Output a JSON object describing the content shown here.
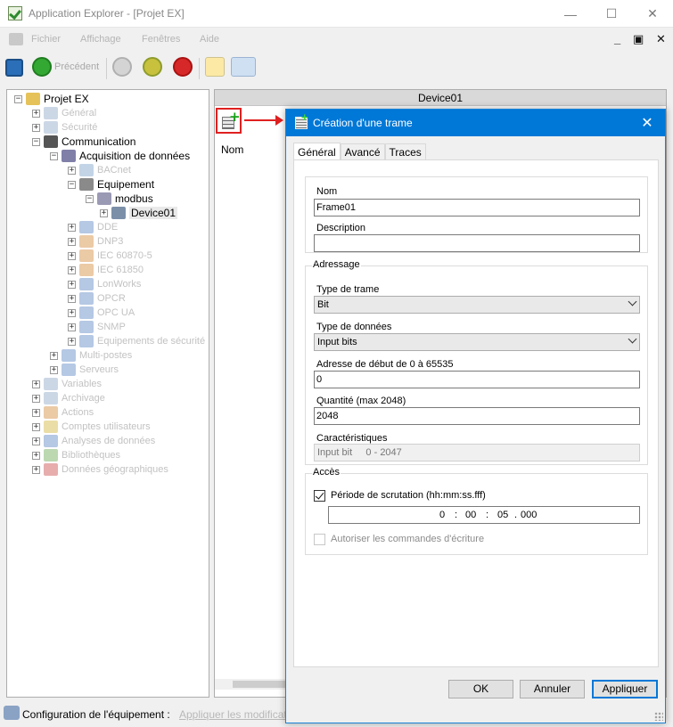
{
  "window": {
    "title": "Application Explorer - [Projet EX]",
    "controls": {
      "minimize": "—",
      "maximize": "☐",
      "close": "✕"
    }
  },
  "menu": {
    "items": [
      "Fichier",
      "Affichage",
      "Fenêtres",
      "Aide"
    ],
    "mdi_controls": {
      "minimize": "_",
      "restore": "▣",
      "close": "✕"
    }
  },
  "toolbar": {
    "previous_label": "Précédent"
  },
  "tree": {
    "root": "Projet EX",
    "items": [
      {
        "label": "Général",
        "dim": true
      },
      {
        "label": "Sécurité",
        "dim": true
      },
      {
        "label": "Communication",
        "dim": false
      },
      {
        "label": "Acquisition de données",
        "dim": false
      },
      {
        "label": "BACnet",
        "dim": true
      },
      {
        "label": "Equipement",
        "dim": false
      },
      {
        "label": "modbus",
        "dim": false
      },
      {
        "label": "Device01",
        "dim": false,
        "selected": true
      },
      {
        "label": "DDE",
        "dim": true
      },
      {
        "label": "DNP3",
        "dim": true
      },
      {
        "label": "IEC 60870-5",
        "dim": true
      },
      {
        "label": "IEC 61850",
        "dim": true
      },
      {
        "label": "LonWorks",
        "dim": true
      },
      {
        "label": "OPCR",
        "dim": true
      },
      {
        "label": "OPC UA",
        "dim": true
      },
      {
        "label": "SNMP",
        "dim": true
      },
      {
        "label": "Equipements de sécurité",
        "dim": true
      },
      {
        "label": "Multi-postes",
        "dim": true
      },
      {
        "label": "Serveurs",
        "dim": true
      },
      {
        "label": "Variables",
        "dim": true
      },
      {
        "label": "Archivage",
        "dim": true
      },
      {
        "label": "Actions",
        "dim": true
      },
      {
        "label": "Comptes utilisateurs",
        "dim": true
      },
      {
        "label": "Analyses de données",
        "dim": true
      },
      {
        "label": "Bibliothèques",
        "dim": true
      },
      {
        "label": "Données géographiques",
        "dim": true
      }
    ]
  },
  "right_panel": {
    "header": "Device01",
    "column_name": "Nom"
  },
  "status": {
    "label": "Configuration de l'équipement :",
    "link": "Appliquer les modifications"
  },
  "dialog": {
    "title": "Création d'une trame",
    "close": "✕",
    "tabs": [
      "Général",
      "Avancé",
      "Traces"
    ],
    "name_label": "Nom",
    "name_value": "Frame01",
    "description_label": "Description",
    "description_value": "",
    "addressing": {
      "title": "Adressage",
      "frame_type_label": "Type de trame",
      "frame_type_value": "Bit",
      "data_type_label": "Type de données",
      "data_type_value": "Input bits",
      "start_address_label": "Adresse de début de 0 à 65535",
      "start_address_value": "0",
      "quantity_label": "Quantité (max 2048)",
      "quantity_value": "2048",
      "characteristics_label": "Caractéristiques",
      "characteristics_value": "Input bit     0 - 2047"
    },
    "access": {
      "title": "Accès",
      "scan_period_label": "Période de scrutation (hh:mm:ss.fff)",
      "scan_period_checked": true,
      "time_parts": [
        "0",
        ":",
        "00",
        ":",
        "05",
        ".",
        "000"
      ],
      "write_commands_label": "Autoriser les commandes d'écriture",
      "write_commands_checked": false
    },
    "buttons": {
      "ok": "OK",
      "cancel": "Annuler",
      "apply": "Appliquer"
    }
  },
  "colors": {
    "accent": "#0078d7",
    "highlight": "#e02020"
  }
}
